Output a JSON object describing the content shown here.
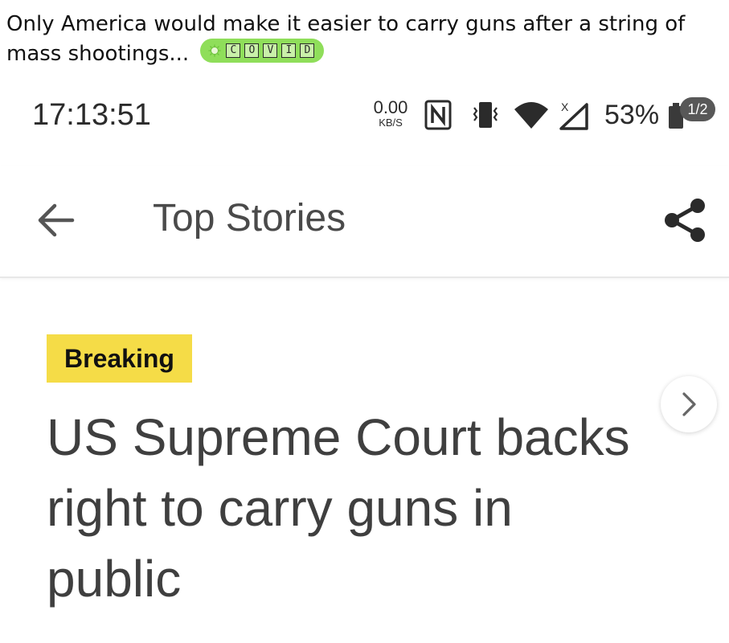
{
  "post": {
    "title": "Only America would make it easier to carry guns after a string of mass shootings...",
    "flair": {
      "icon": "virus-icon",
      "letters": [
        "C",
        "O",
        "V",
        "I",
        "D"
      ],
      "color": "#8fde5a"
    }
  },
  "status_bar": {
    "time": "17:13:51",
    "net_speed": "0.00",
    "net_speed_unit": "KB/S",
    "battery": "53%",
    "page_indicator": "1/2",
    "icons": [
      "nfc-icon",
      "vibrate-icon",
      "wifi-icon",
      "no-signal-icon",
      "battery-icon"
    ]
  },
  "app_bar": {
    "title": "Top Stories",
    "back_icon": "arrow-left-icon",
    "share_icon": "share-icon"
  },
  "article": {
    "badge": "Breaking",
    "badge_color": "#f5dc47",
    "headline": "US Supreme Court backs right to carry guns in public"
  }
}
